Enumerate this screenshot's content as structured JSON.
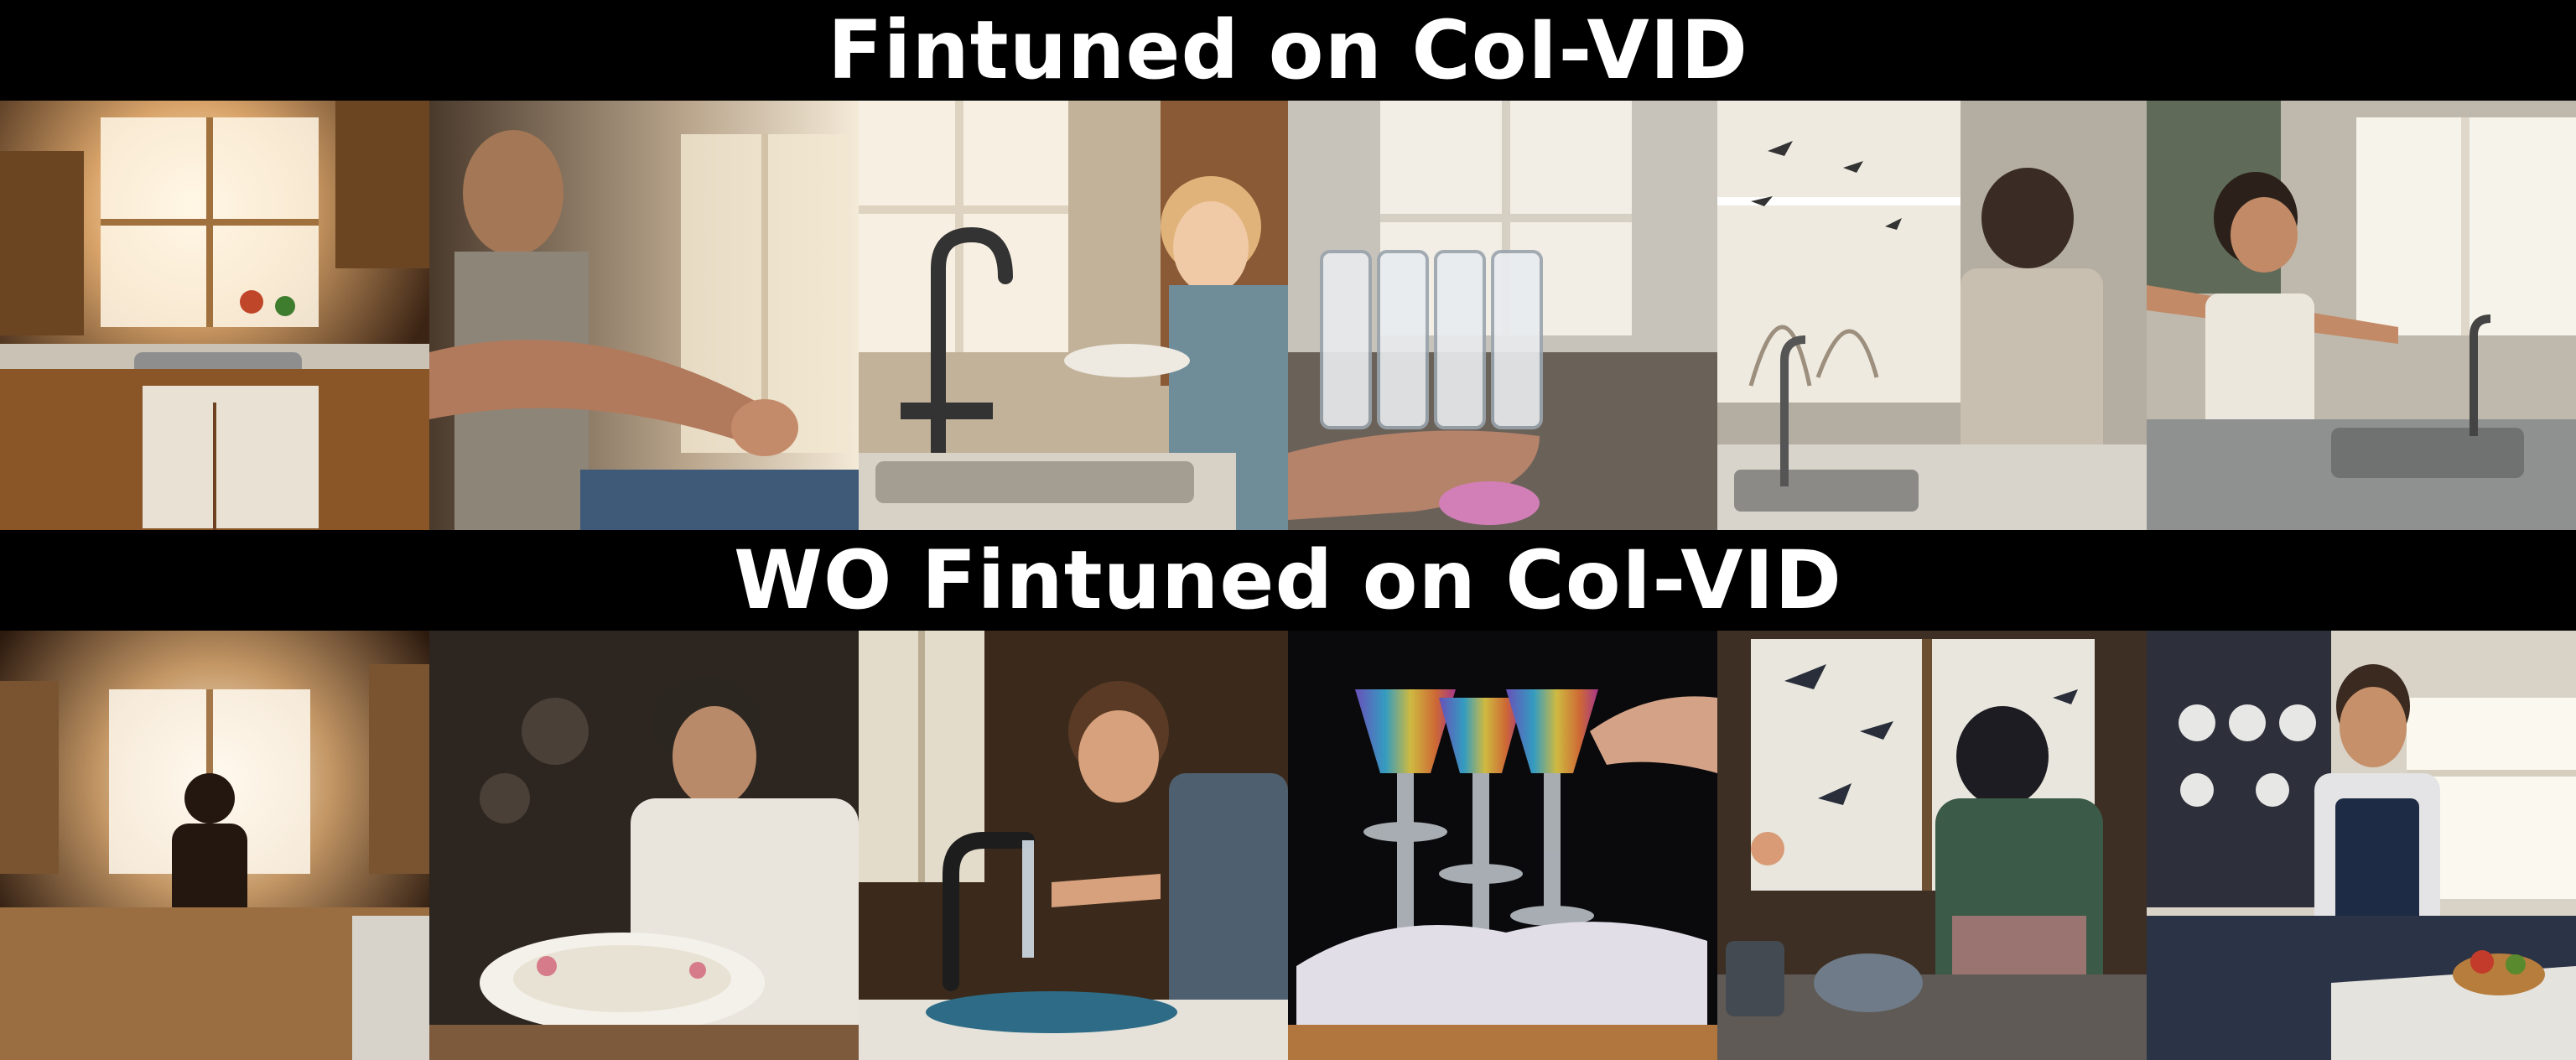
{
  "rows": [
    {
      "title": "Fintuned on CoI-VID",
      "frames": [
        {
          "subject": "kitchen-sink-window-scene"
        },
        {
          "subject": "woman-reaching-hand"
        },
        {
          "subject": "child-holding-plate-at-faucet"
        },
        {
          "subject": "stacked-glasses-held-in-hand"
        },
        {
          "subject": "person-at-window-with-birds"
        },
        {
          "subject": "man-stretching-at-sink"
        }
      ]
    },
    {
      "title": "WO Fintuned on CoI-VID",
      "frames": [
        {
          "subject": "person-silhouette-in-kitchen"
        },
        {
          "subject": "woman-washing-plate"
        },
        {
          "subject": "boy-washing-hands-at-faucet"
        },
        {
          "subject": "rainbow-glasses-on-towel"
        },
        {
          "subject": "person-at-stove-with-birds"
        },
        {
          "subject": "smiling-man-in-apron"
        }
      ]
    }
  ]
}
